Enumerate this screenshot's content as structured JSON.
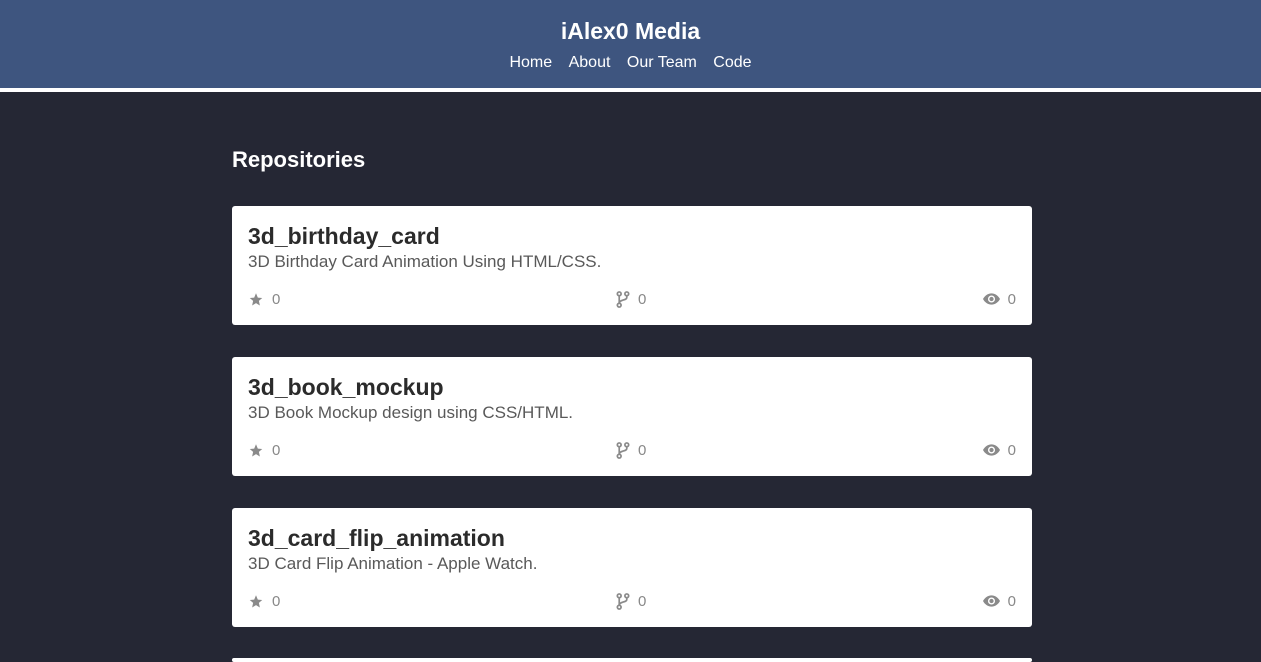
{
  "header": {
    "title": "iAlex0 Media",
    "nav": [
      "Home",
      "About",
      "Our Team",
      "Code"
    ]
  },
  "section": {
    "title": "Repositories"
  },
  "repos": [
    {
      "name": "3d_birthday_card",
      "description": "3D Birthday Card Animation Using HTML/CSS.",
      "stars": "0",
      "forks": "0",
      "watchers": "0"
    },
    {
      "name": "3d_book_mockup",
      "description": "3D Book Mockup design using CSS/HTML.",
      "stars": "0",
      "forks": "0",
      "watchers": "0"
    },
    {
      "name": "3d_card_flip_animation",
      "description": "3D Card Flip Animation - Apple Watch.",
      "stars": "0",
      "forks": "0",
      "watchers": "0"
    },
    {
      "name": "",
      "description": "",
      "stars": "",
      "forks": "",
      "watchers": ""
    }
  ],
  "icons": {
    "star": "star-icon",
    "fork": "fork-icon",
    "watch": "eye-icon"
  },
  "colors": {
    "header_bg": "#3e557f",
    "page_bg": "#252734",
    "card_bg": "#ffffff",
    "icon_gray": "#888888"
  }
}
